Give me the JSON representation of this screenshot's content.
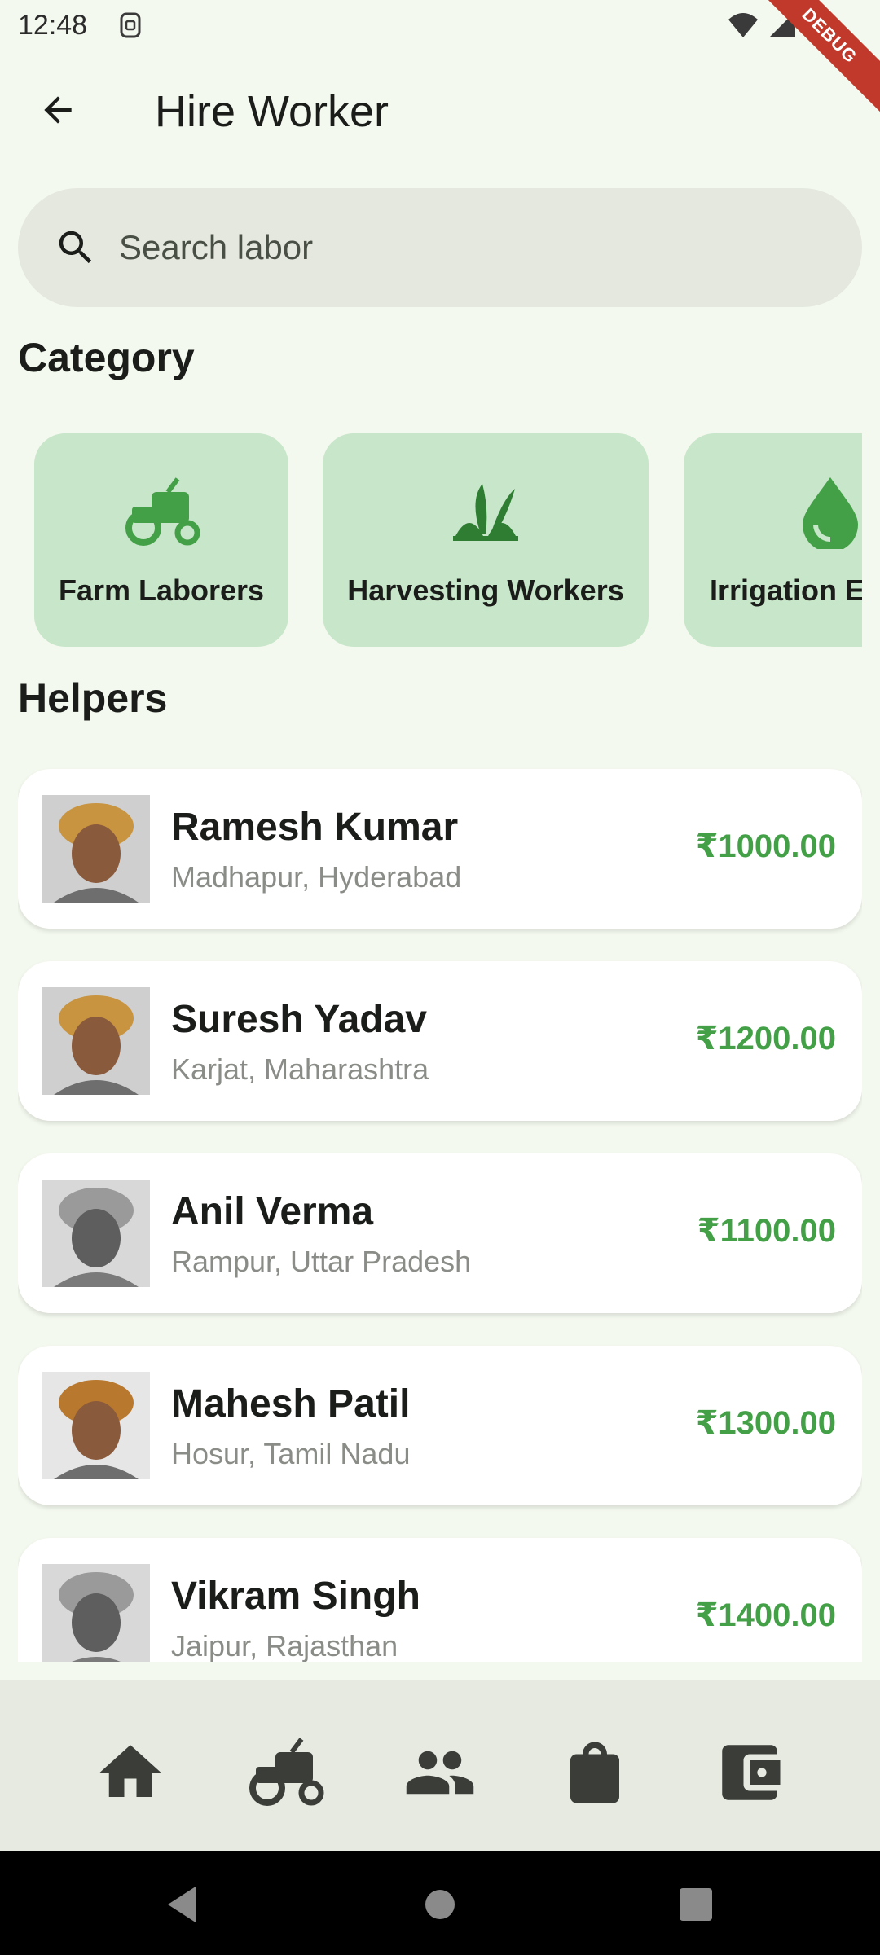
{
  "status_bar": {
    "time": "12:48",
    "debug_label": "DEBUG"
  },
  "app_bar": {
    "title": "Hire Worker",
    "back_icon": "arrow-back-icon"
  },
  "search": {
    "placeholder": "Search labor",
    "value": ""
  },
  "sections": {
    "category_title": "Category",
    "helpers_title": "Helpers"
  },
  "categories": [
    {
      "label": "Farm Laborers",
      "icon": "tractor-icon"
    },
    {
      "label": "Harvesting Workers",
      "icon": "grass-icon"
    },
    {
      "label": "Irrigation E",
      "icon": "water-drop-icon"
    }
  ],
  "helpers": [
    {
      "name": "Ramesh Kumar",
      "location": "Madhapur, Hyderabad",
      "price": "₹1000.00"
    },
    {
      "name": "Suresh Yadav",
      "location": "Karjat, Maharashtra",
      "price": "₹1200.00"
    },
    {
      "name": "Anil Verma",
      "location": "Rampur, Uttar Pradesh",
      "price": "₹1100.00"
    },
    {
      "name": "Mahesh Patil",
      "location": "Hosur, Tamil Nadu",
      "price": "₹1300.00"
    },
    {
      "name": "Vikram Singh",
      "location": "Jaipur, Rajasthan",
      "price": "₹1400.00"
    }
  ],
  "bottom_nav": [
    "home-icon",
    "tractor-icon",
    "people-icon",
    "shopping-bag-icon",
    "wallet-icon"
  ],
  "colors": {
    "accent_green": "#43a047",
    "category_bg": "#c8e6c9",
    "page_bg": "#f4f9ef",
    "nav_icon": "#3a3d38"
  }
}
